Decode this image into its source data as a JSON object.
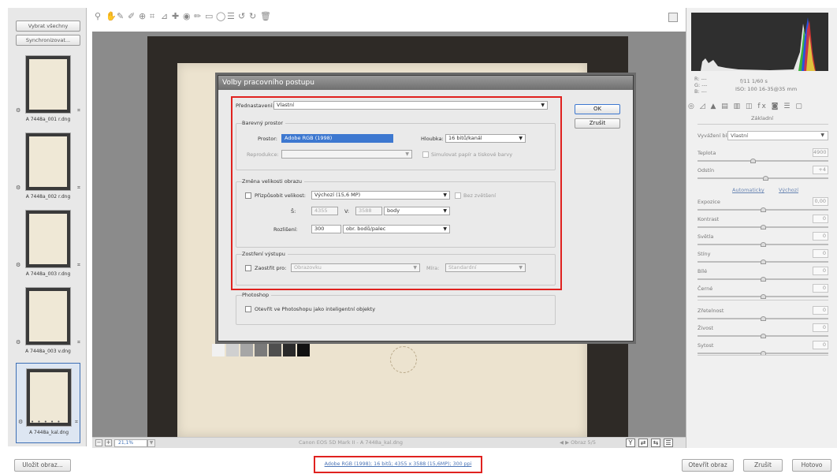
{
  "filmstrip": {
    "select_all": "Vybrat všechny",
    "sync": "Synchronizovat...",
    "items": [
      {
        "label": "A 7448a_001 r.dng"
      },
      {
        "label": "A 7448a_002 r.dng"
      },
      {
        "label": "A 7448a_003 r.dng"
      },
      {
        "label": "A 7448a_003 v.dng"
      },
      {
        "label": "A 7448a_kal.dng",
        "rating": "• • • • •"
      }
    ]
  },
  "toolbar": {
    "icons": [
      "zoom-icon",
      "hand-icon",
      "white-balance-icon",
      "color-sampler-icon",
      "target-adjust-icon",
      "crop-icon",
      "straighten-icon",
      "spot-removal-icon",
      "red-eye-icon",
      "adjustment-brush-icon",
      "graduated-filter-icon",
      "radial-filter-icon",
      "preferences-icon",
      "rotate-left-icon",
      "rotate-right-icon",
      "trash-icon"
    ],
    "glyphs": [
      "⚲",
      "✋",
      "✎",
      "✐",
      "⊕",
      "⌗",
      "⊿",
      "✚",
      "◉",
      "✏",
      "▭",
      "◯",
      "☰",
      "↺",
      "↻",
      "🗑"
    ]
  },
  "status": {
    "zoom": "21,1%",
    "camera": "Canon EOS 5D Mark II  -  A 7448a_kal.dng",
    "nav": "◀  ▶  Obraz 5/5",
    "view_label": "Y"
  },
  "panel": {
    "rgb": [
      "R:  ---",
      "G:  ---",
      "B:  ---"
    ],
    "exif_line1": "f/11  1/60 s",
    "exif_line2": "ISO: 100  16-35@35 mm",
    "tab_glyphs": "◎ ◿ ▲ ▤ ▥ ◫ fx ◙ ☰ ▢",
    "section": "Základní",
    "wb_label": "Vyvážení bílé:",
    "wb_value": "Vlastní",
    "auto": "Automaticky",
    "default": "Výchozí",
    "sliders": [
      {
        "name": "Teplota",
        "value": "4900",
        "pos": 0.42
      },
      {
        "name": "Odstín",
        "value": "+4",
        "pos": 0.52
      },
      {
        "name": "Expozice",
        "value": "0,00",
        "pos": 0.5
      },
      {
        "name": "Kontrast",
        "value": "0",
        "pos": 0.5
      },
      {
        "name": "Světla",
        "value": "0",
        "pos": 0.5
      },
      {
        "name": "Stíny",
        "value": "0",
        "pos": 0.5
      },
      {
        "name": "Bílé",
        "value": "0",
        "pos": 0.5
      },
      {
        "name": "Černé",
        "value": "0",
        "pos": 0.5
      },
      {
        "name": "Zřetelnost",
        "value": "0",
        "pos": 0.5
      },
      {
        "name": "Živost",
        "value": "0",
        "pos": 0.5
      },
      {
        "name": "Sytost",
        "value": "0",
        "pos": 0.5
      }
    ]
  },
  "bottom": {
    "save": "Uložit obraz...",
    "workflow_link": "Adobe RGB (1998); 16 bitů; 4355 x 3588 (15,6MP); 300 ppi",
    "open": "Otevřít obraz",
    "cancel": "Zrušit",
    "done": "Hotovo"
  },
  "dialog": {
    "title": "Volby pracovního postupu",
    "ok": "OK",
    "cancel": "Zrušit",
    "preset_label": "Přednastavení:",
    "preset_value": "Vlastní",
    "color_space": {
      "group": "Barevný prostor",
      "space_label": "Prostor:",
      "space_value": "Adobe RGB (1998)",
      "depth_label": "Hloubka:",
      "depth_value": "16 bitů/kanál",
      "intent_label": "Reprodukce:",
      "simulate_label": "Simulovat papír a tiskové barvy"
    },
    "resize": {
      "group": "Změna velikosti obrazu",
      "fit_label": "Přizpůsobit velikost:",
      "fit_value": "Výchozí (15,6 MP)",
      "no_enlarge": "Bez zvětšení",
      "w_label": "Š:",
      "w_value": "4355",
      "h_label": "V:",
      "h_value": "3588",
      "unit_value": "body",
      "res_label": "Rozlišení:",
      "res_value": "300",
      "res_unit": "obr. bodů/palec"
    },
    "sharpen": {
      "group": "Zostření výstupu",
      "for_label": "Zaostřit pro:",
      "for_value": "Obrazovku",
      "amount_label": "Míra:",
      "amount_value": "Standardní"
    },
    "photoshop": {
      "group": "Photoshop",
      "smart_label": "Otevřít ve Photoshopu jako inteligentní objekty"
    }
  }
}
